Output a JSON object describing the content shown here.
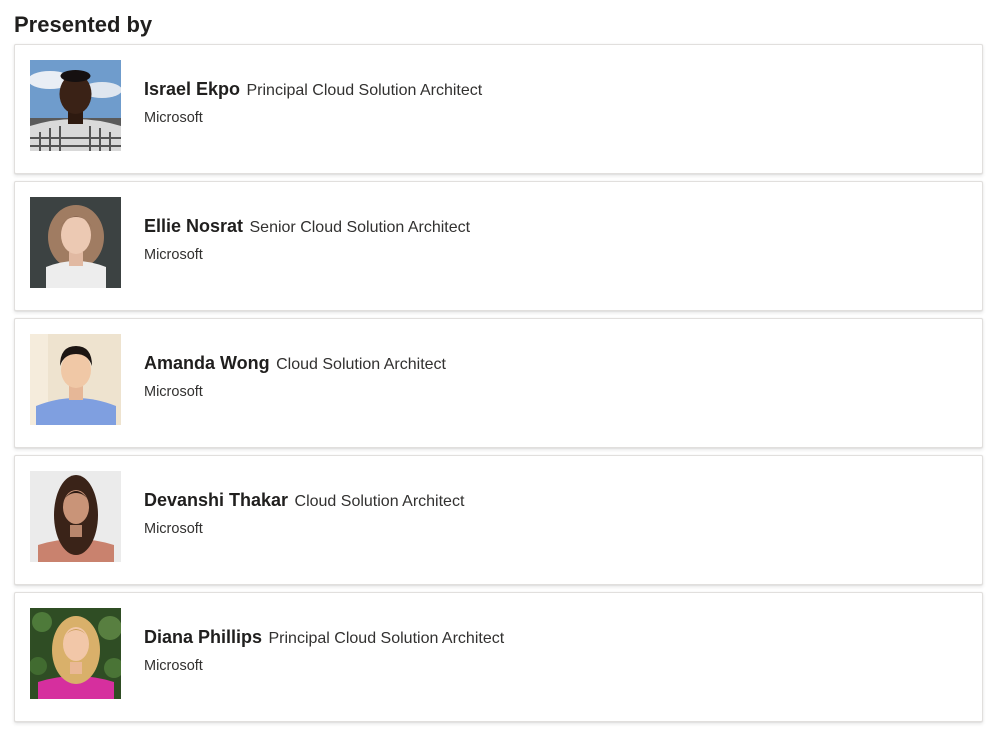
{
  "section": {
    "heading": "Presented by"
  },
  "presenters": [
    {
      "name": "Israel Ekpo",
      "title": "Principal Cloud Solution Architect",
      "organization": "Microsoft",
      "photo_icon": "avatar-photo-icon"
    },
    {
      "name": "Ellie Nosrat",
      "title": "Senior Cloud Solution Architect",
      "organization": "Microsoft",
      "photo_icon": "avatar-photo-icon"
    },
    {
      "name": "Amanda Wong",
      "title": "Cloud Solution Architect",
      "organization": "Microsoft",
      "photo_icon": "avatar-photo-icon"
    },
    {
      "name": "Devanshi Thakar",
      "title": "Cloud Solution Architect",
      "organization": "Microsoft",
      "photo_icon": "avatar-photo-icon"
    },
    {
      "name": "Diana Phillips",
      "title": "Principal Cloud Solution Architect",
      "organization": "Microsoft",
      "photo_icon": "avatar-photo-icon"
    }
  ],
  "colors": {
    "card_border": "#e1dfdd",
    "text_primary": "#201f1e",
    "text_secondary": "#323130"
  }
}
